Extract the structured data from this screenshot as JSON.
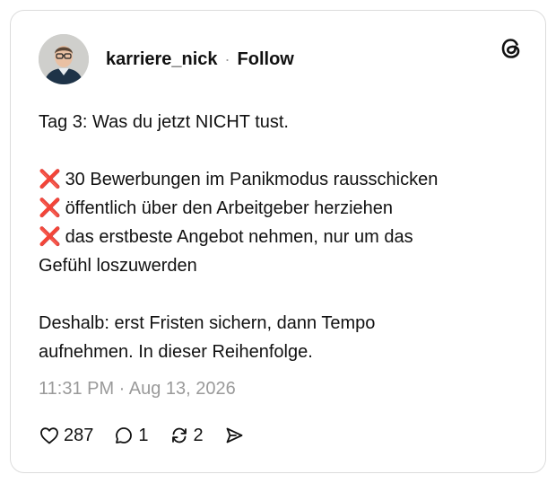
{
  "post": {
    "username": "karriere_nick",
    "separator": "·",
    "follow_label": "Follow",
    "intro": "Tag 3: Was du jetzt NICHT tust.",
    "bullet_mark": "❌",
    "bullets": [
      "30 Bewerbungen im Panikmodus rausschicken",
      "öffentlich über den Arbeitgeber herziehen",
      "das erstbeste Angebot nehmen, nur um das"
    ],
    "continuation": "Gefühl loszuwerden",
    "closing_line1": "Deshalb: erst Fristen sichern, dann Tempo",
    "closing_line2": "aufnehmen. In dieser Reihenfolge.",
    "timestamp": "11:31 PM · Aug 13, 2026"
  },
  "actions": {
    "likes": "287",
    "replies": "1",
    "reposts": "2",
    "icons": [
      "heart-icon",
      "reply-icon",
      "repost-icon",
      "share-icon"
    ]
  },
  "colors": {
    "text": "#111111",
    "muted": "#9a9a9a",
    "border": "#dcdcdc",
    "x_mark": "#e02424"
  }
}
